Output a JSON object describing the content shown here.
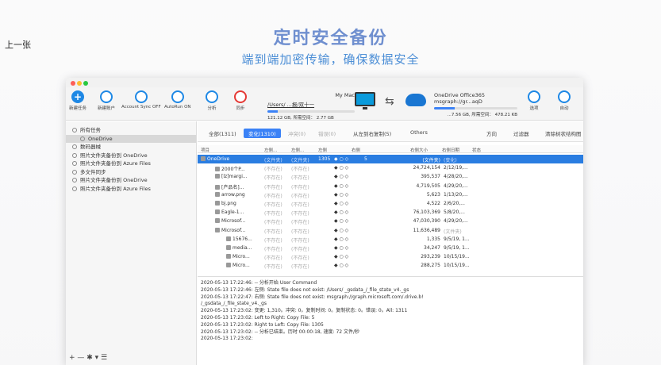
{
  "page": {
    "prev_link": "上一张",
    "hero_title": "定时安全备份",
    "hero_subtitle": "端到端加密传输，确保数据安全"
  },
  "toolbar": {
    "new_task": "新建任务",
    "new_account": "新建账户",
    "account_sync": "Account Sync OFF",
    "autorun": "AutoRun ON",
    "analyze": "分析",
    "sync": "同步",
    "options": "选项",
    "auto": "自动"
  },
  "source": {
    "label": "My Mac",
    "path": "/Users/ ...报/双十一",
    "capacity": "121.12 GB, 所需空间： 2.77 GB",
    "used_fraction": 0.12
  },
  "destination": {
    "label": "OneDrive Office365",
    "path": "msgraph://gr...aqD",
    "capacity": "...7.56 GB, 所需空间： 478.21 KB",
    "used_fraction": 0.25
  },
  "sidebar": {
    "items": [
      {
        "label": "所有任务",
        "level": 1
      },
      {
        "label": "OneDrive",
        "level": 2,
        "selected": true
      },
      {
        "label": "数码器械",
        "level": 1
      },
      {
        "label": "照片文件夹备份到 OneDrive",
        "level": 1
      },
      {
        "label": "照片文件夹备份到 Azure Files",
        "level": 1
      },
      {
        "label": "多文件同步",
        "level": 1
      },
      {
        "label": "照片文件夹备份到 OneDrive",
        "level": 1
      },
      {
        "label": "照片文件夹备份到 Azure Files",
        "level": 1
      }
    ],
    "footer": "+ — ✱ ▾ ☰"
  },
  "filters": {
    "all": "全部(1311)",
    "changed": "变化(1310)",
    "conflict": "冲突(0)",
    "skipped": "错误(0)",
    "direction_copy": "从左到右复制(5)",
    "others": "Others",
    "direction": "方向",
    "filter": "过滤器",
    "clear_tree": "清除树状结构图"
  },
  "columns": {
    "item": "项目",
    "left_size": "左侧...",
    "left_date": "左侧...",
    "left": "左侧",
    "right": "右侧",
    "right_size": "右侧大小",
    "right_date": "右侧日期",
    "status": "状态"
  },
  "rows": [
    {
      "name": "OneDrive",
      "c1": "(文件夹)",
      "c2": "(文件夹)",
      "c3": "1305",
      "c4": "5",
      "size": "(文件夹)",
      "date": "(变化)",
      "selected": true
    },
    {
      "name": "2000个P...",
      "c1": "(不存在)",
      "c2": "(不存在)",
      "size": "24,724,154",
      "date": "2/12/19,..."
    },
    {
      "name": "[lz]margi...",
      "c1": "(不存在)",
      "c2": "(不存在)",
      "size": "395,537",
      "date": "4/28/20,..."
    },
    {
      "name": "[产品名]...",
      "c1": "(不存在)",
      "c2": "(不存在)",
      "size": "4,719,505",
      "date": "4/29/20,..."
    },
    {
      "name": "arrow.png",
      "c1": "(不存在)",
      "c2": "(不存在)",
      "size": "5,623",
      "date": "1/13/20,..."
    },
    {
      "name": "bj.png",
      "c1": "(不存在)",
      "c2": "(不存在)",
      "size": "4,522",
      "date": "2/6/20,..."
    },
    {
      "name": "Eagle-1...",
      "c1": "(不存在)",
      "c2": "(不存在)",
      "size": "76,103,369",
      "date": "5/8/20,..."
    },
    {
      "name": "Microsof...",
      "c1": "(不存在)",
      "c2": "(不存在)",
      "size": "47,030,390",
      "date": "4/29/20,..."
    },
    {
      "name": "Microsof...",
      "c1": "(不存在)",
      "c2": "(不存在)",
      "size": "11,636,489",
      "date": "(文件夹)"
    },
    {
      "name": "15676...",
      "c1": "(不存在)",
      "c2": "(不存在)",
      "size": "1,335",
      "date": "9/5/19, 1..."
    },
    {
      "name": "media...",
      "c1": "(不存在)",
      "c2": "(不存在)",
      "size": "34,247",
      "date": "9/5/19, 1..."
    },
    {
      "name": "Micro...",
      "c1": "(不存在)",
      "c2": "(不存在)",
      "size": "293,239",
      "date": "10/15/19..."
    },
    {
      "name": "Micro...",
      "c1": "(不存在)",
      "c2": "(不存在)",
      "size": "288,275",
      "date": "10/15/19..."
    }
  ],
  "log": [
    "2020-05-13 17:22:46: -- 分析开始 User Command",
    "2020-05-13 17:22:46: 左侧: State file does not exist: /Users/                                    _gsdata_/_file_state_v4._gs",
    "2020-05-13 17:22:47: 右侧: State file does not exist: msgraph://graph.microsoft.com/.drive.b!",
    "                                                                                                /_gsdata_/_file_state_v4._gs",
    "2020-05-13 17:23:02: 变更: 1,310。冲突: 0。复制时间: 0。复制状态: 0。错误: 0。All: 1311",
    "2020-05-13 17:23:02: Left to Right: Copy File: 5",
    "2020-05-13 17:23:02: Right to Left: Copy File: 1305",
    "2020-05-13 17:23:02: -- 分析已结束。历时 00:00:18, 速度: 72 文件/秒",
    "2020-05-13 17:23:02:"
  ]
}
